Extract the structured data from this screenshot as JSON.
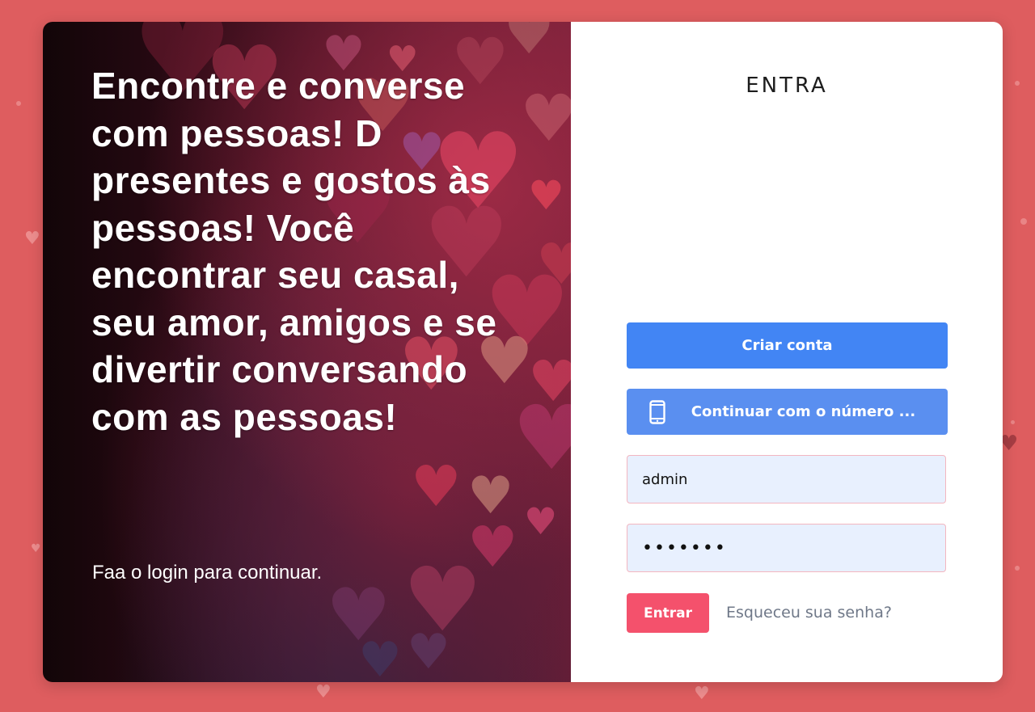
{
  "hero": {
    "headline": "Encontre e converse com pessoas! D presentes e gostos às pessoas! Você encontrar seu casal, seu amor, amigos e se divertir conversando com as pessoas!",
    "subtext": "Faa o login para continuar."
  },
  "login": {
    "title": "ENTRA",
    "create_account_label": "Criar conta",
    "phone_label": "Continuar com o número ...",
    "username_value": "admin",
    "password_value": "•••••••",
    "submit_label": "Entrar",
    "forgot_label": "Esqueceu sua senha?"
  },
  "colors": {
    "page_background": "#de5d5f",
    "primary_blue": "#4285f4",
    "phone_blue": "#5a8ff0",
    "login_red": "#f4516c",
    "input_background": "#e8f0fe"
  },
  "icons": {
    "phone_button": "smartphone-icon",
    "decoration": "heart-icon"
  }
}
